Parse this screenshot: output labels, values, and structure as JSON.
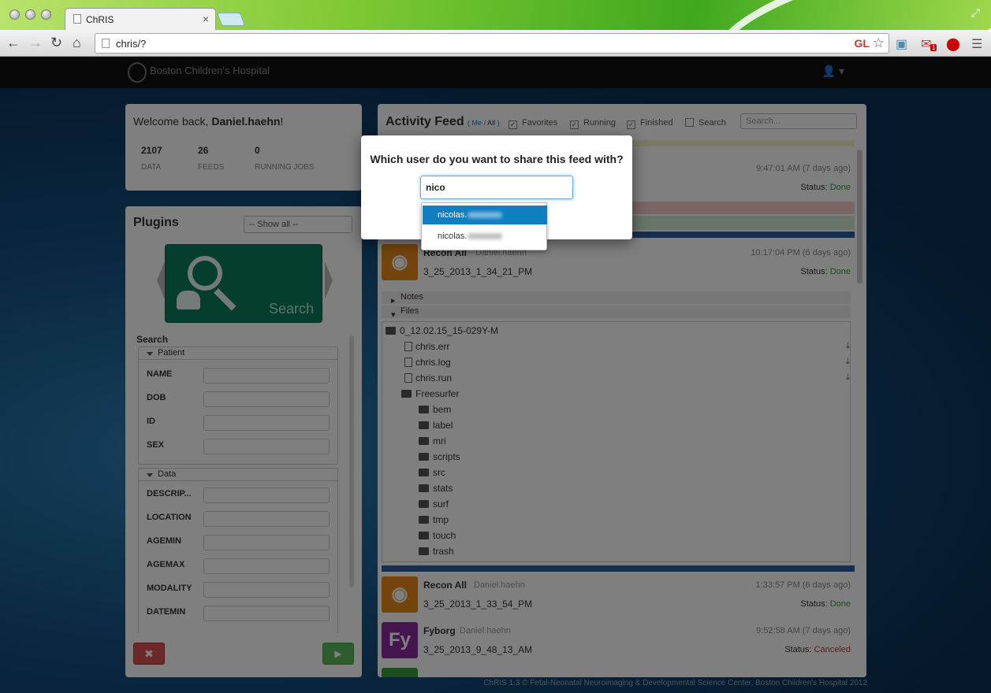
{
  "browser": {
    "tab_title": "ChRIS",
    "url": "chris/?",
    "omnibox_badge": "GL",
    "mail_badge": "1"
  },
  "navbar": {
    "brand": "Boston Children's Hospital",
    "user_icon": "user-icon"
  },
  "welcome": {
    "greeting": "Welcome back, ",
    "username": "Daniel.haehn",
    "suffix": "!",
    "stats": [
      {
        "value": "2107",
        "label": "DATA"
      },
      {
        "value": "26",
        "label": "FEEDS"
      },
      {
        "value": "0",
        "label": "RUNNING JOBS"
      }
    ]
  },
  "plugins": {
    "title": "Plugins",
    "filter": "-- Show all --",
    "tile_label": "Search",
    "form_title": "Search",
    "patient_legend": "Patient",
    "patient_fields": [
      "NAME",
      "DOB",
      "ID",
      "SEX"
    ],
    "data_legend": "Data",
    "data_fields": [
      "DESCRIP...",
      "LOCATION",
      "AGEMIN",
      "AGEMAX",
      "MODALITY",
      "DATEMIN"
    ]
  },
  "feed": {
    "title": "Activity Feed",
    "me": "Me",
    "sep": " / ",
    "all": "All",
    "filters": [
      "Favorites",
      "Running",
      "Finished",
      "Search"
    ],
    "search_placeholder": "Search...",
    "items": [
      {
        "time": "9:47:01 AM (7 days ago)",
        "status_label": "Status: ",
        "status": "Done"
      },
      {
        "plugin": "Recon All",
        "owner": "Daniel.haehn",
        "time": "10:17:04 PM (6 days ago)",
        "job": "3_25_2013_1_34_21_PM",
        "status_label": "Status: ",
        "status": "Done"
      },
      {
        "plugin": "Recon All",
        "owner": "Daniel.haehn",
        "time": "1:33:57 PM (6 days ago)",
        "job": "3_25_2013_1_33_54_PM",
        "status_label": "Status: ",
        "status": "Done"
      },
      {
        "plugin": "Fyborg",
        "owner": "Daniel.haehn",
        "time": "9:52:58 AM (7 days ago)",
        "job": "3_25_2013_9_48_13_AM",
        "status_label": "Status: ",
        "status": "Canceled"
      }
    ],
    "notes_label": "Notes",
    "files_label": "Files",
    "tree_root": "0_12.02.15_15-029Y-M",
    "tree_files": [
      "chris.err",
      "chris.log",
      "chris.run"
    ],
    "tree_sub": "Freesurfer",
    "tree_folders": [
      "bem",
      "label",
      "mri",
      "scripts",
      "src",
      "stats",
      "surf",
      "tmp",
      "touch",
      "trash"
    ]
  },
  "footer": "ChRIS 1.3 © Fetal-Neonatal Neuroimaging & Developmental Science Center, Boston Children's Hospital 2012",
  "modal": {
    "question": "Which user do you want to share this feed with?",
    "input_value": "nico",
    "suggestions": [
      {
        "match": "nico",
        "rest": "las."
      },
      {
        "match": "nico",
        "rest": "las."
      }
    ]
  }
}
